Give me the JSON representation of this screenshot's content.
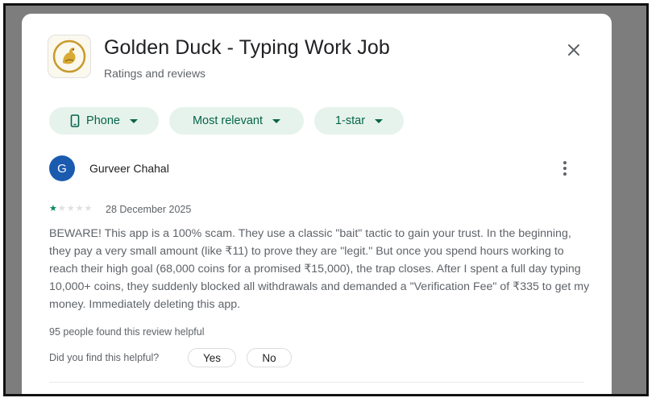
{
  "app": {
    "title": "Golden Duck - Typing Work Job",
    "subtitle": "Ratings and reviews",
    "icon": "golden-duck-logo"
  },
  "filters": [
    {
      "label": "Phone",
      "icon": "phone-icon"
    },
    {
      "label": "Most relevant"
    },
    {
      "label": "1-star"
    }
  ],
  "review": {
    "avatar_letter": "G",
    "avatar_color": "#1a5bb0",
    "reviewer": "Gurveer Chahal",
    "rating": 1,
    "max_rating": 5,
    "date": "28 December 2025",
    "text": "BEWARE! This app is a 100% scam. They use a classic \"bait\" tactic to gain your trust. In the beginning, they pay a very small amount (like ₹11) to prove they are \"legit.\" But once you spend hours working to reach their high goal (68,000 coins for a promised ₹15,000), the trap closes. After I spent a full day typing 10,000+ coins, they suddenly blocked all withdrawals and demanded a \"Verification Fee\" of ₹335 to get my money. Immediately deleting this app.",
    "helpful_count": "95 people found this review helpful",
    "helpful_question": "Did you find this helpful?",
    "yes_label": "Yes",
    "no_label": "No"
  },
  "colors": {
    "chip_bg": "#e6f3ec",
    "chip_text": "#056449",
    "star_filled": "#01875f",
    "star_empty": "#e0e0e0",
    "overlay": "#7d7d7d"
  }
}
